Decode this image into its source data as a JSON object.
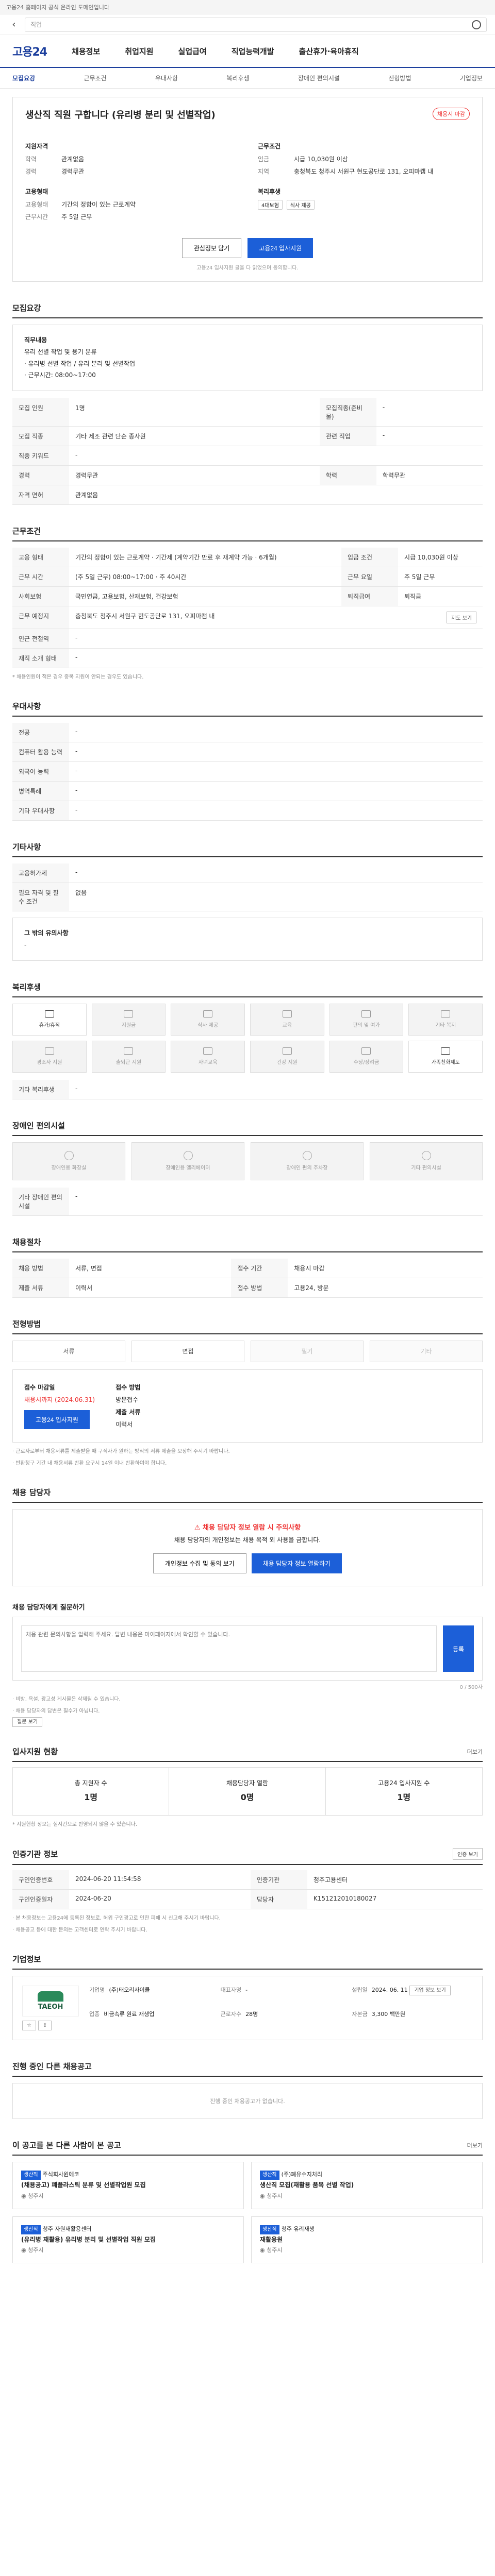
{
  "topbar": {
    "notice": "고용24 홈페이지 공식 온라인 도메인입니다"
  },
  "search": {
    "placeholder": "직업"
  },
  "gnb": {
    "logo": "고용24",
    "items": [
      "채용정보",
      "취업지원",
      "실업급여",
      "직업능력개발",
      "출산휴가·육아휴직"
    ]
  },
  "subtabs": [
    "모집요강",
    "근무조건",
    "우대사항",
    "복리후생",
    "장애인 편의시설",
    "전형방법",
    "기업정보"
  ],
  "job": {
    "title": "생산직 직원 구합니다 (유리병 분리 및 선별작업)",
    "status": "채용시 마감",
    "company_h": "지원자격",
    "edu_k": "학력",
    "edu_v": "관계없음",
    "career_k": "경력",
    "career_v": "경력무관",
    "cond_h": "근무조건",
    "pay_k": "임금",
    "pay_v": "시급 10,030원 이상",
    "area_k": "지역",
    "area_v": "충청북도 청주시 서원구 현도공단로 131, 오피마캠 내",
    "emp_h": "고용형태",
    "type_k": "고용형태",
    "type_v": "기간의 정함이 있는 근로계약",
    "hours_k": "근무시간",
    "hours_v": "주 5일 근무",
    "benefit_h": "복리후생",
    "benefit_tags": [
      "4대보험",
      "식사 제공"
    ],
    "btn_scrap": "관심정보 담기",
    "btn_apply": "고용24 입사지원",
    "apply_note": "고용24 입사지원 글을 다 읽었으며 동의합니다."
  },
  "recruit": {
    "title": "모집요강",
    "desc_lines": [
      "직무내용",
      "유리 선별 작업 및 용기 분류",
      "· 유리병 선별 작업 / 유리 분리 및 선별작업",
      "· 근무시간: 08:00~17:00"
    ],
    "rows": [
      {
        "k": "모집 인원",
        "v": "1명",
        "k2": "모집직종(준비물)",
        "v2": "-"
      },
      {
        "k": "모집 직종",
        "v": "기타 제조 관련 단순 종사원",
        "k2": "관련 직업",
        "v2": "-"
      },
      {
        "k": "직종 키워드",
        "v": "-",
        "k2": "",
        "v2": ""
      },
      {
        "k": "경력",
        "v": "경력무관",
        "k2": "학력",
        "v2": "학력무관"
      },
      {
        "k": "자격 면허",
        "v": "관계없음",
        "k2": "",
        "v2": ""
      }
    ]
  },
  "work": {
    "title": "근무조건",
    "rows": [
      {
        "k": "고용 형태",
        "v": "기간의 정함이 있는 근로계약 · 기간제 (계약기간 만료 후 재계약 가능 · 6개월)"
      },
      {
        "k": "임금 조건",
        "v": "시급 10,030원 이상"
      },
      {
        "k": "근무 시간",
        "v": "(주 5일 근무) 08:00~17:00 · 주 40시간"
      },
      {
        "k": "근무 요일",
        "v": "주 5일 근무"
      },
      {
        "k": "사회보험",
        "v": "국민연금, 고용보험, 산재보험, 건강보험"
      },
      {
        "k": "퇴직급여",
        "v": "퇴직금"
      },
      {
        "k": "근무 예정지",
        "v": "충청북도 청주시 서원구 현도공단로 131, 오피마캠 내"
      },
      {
        "k": "인근 전철역",
        "v": "-"
      },
      {
        "k": "재직 소개 형태",
        "v": "-"
      }
    ],
    "note": "* 채용인원이 적은 경우 중복 지원이 안되는 경우도 있습니다.",
    "map_btn": "지도 보기"
  },
  "pref": {
    "title": "우대사항",
    "rows": [
      {
        "k": "전공",
        "v": "-"
      },
      {
        "k": "컴퓨터 활용 능력",
        "v": "-"
      },
      {
        "k": "외국어 능력",
        "v": "-"
      },
      {
        "k": "병역특례",
        "v": "-"
      },
      {
        "k": "기타 우대사항",
        "v": "-"
      }
    ]
  },
  "extra": {
    "title": "기타사항",
    "rows": [
      {
        "k": "고용허가제",
        "v": "-"
      },
      {
        "k": "필요 자격 및 필수 조건",
        "v": "없음"
      }
    ],
    "notes_k": "그 밖의 유의사항",
    "notes_v": "-"
  },
  "welfare": {
    "title": "복리후생",
    "items": [
      "휴가/휴직",
      "지원금",
      "식사 제공",
      "교육",
      "편의 및 여가",
      "기타 복지",
      "경조사 지원",
      "출퇴근 지원",
      "자녀교육",
      "건강 지원",
      "수당/장려금",
      "가족친화제도"
    ],
    "active": [
      0,
      11
    ],
    "other_k": "기타 복리후생",
    "other_v": "-"
  },
  "facility": {
    "title": "장애인 편의시설",
    "items": [
      "장애인용 화장실",
      "장애인용 엘리베이터",
      "장애인 편의 주차장",
      "기타 편의시설"
    ],
    "other_k": "기타 장애인 편의시설",
    "other_v": "-"
  },
  "selection": {
    "title": "채용절차",
    "rows": [
      {
        "k": "채용 방법",
        "v": "서류, 면접"
      },
      {
        "k": "접수 기간",
        "v": "채용시 마감"
      },
      {
        "k": "제출 서류",
        "v": "이력서"
      },
      {
        "k": "접수 방법",
        "v": "고용24, 방문"
      }
    ]
  },
  "method": {
    "title": "전형방법",
    "btns": [
      "서류",
      "면접",
      "필기",
      "기타"
    ],
    "off": [
      2,
      3
    ],
    "deadline_k": "접수 마감일",
    "deadline_v": "채용시까지 (2024.06.31)",
    "app_k": "접수 방법",
    "app_v": "방문접수",
    "docs_k": "제출 서류",
    "docs_v": "이력서",
    "apply_btn": "고용24 입사지원",
    "notes": [
      "· 근로자로부터 채용서류를 제출받을 때 구직자가 원하는 방식의 서류 제출을 보장해 주시기 바랍니다.",
      "· 반환청구 기간 내 채용서류 반환 요구시 14일 이내 반환하여야 합니다."
    ]
  },
  "contact": {
    "title": "채용 담당자",
    "warn_title": "채용 담당자 정보 열람 시 주의사항",
    "warn_text": "채용 담당자의 개인정보는 채용 목적 외 사용을 금합니다.",
    "btn1": "개인정보 수집 및 동의 보기",
    "btn2": "채용 담당자 정보 열람하기"
  },
  "qa": {
    "title": "채용 담당자에게 질문하기",
    "placeholder": "채용 관련 문의사항을 입력해 주세요. 답변 내용은 마이페이지에서 확인할 수 있습니다.",
    "submit": "등록",
    "count": "0 / 500자",
    "notes": [
      "· 비방, 욕설, 광고성 게시물은 삭제될 수 있습니다.",
      "· 채용 담당자의 답변은 필수가 아닙니다."
    ],
    "more_btn": "질문 보기"
  },
  "applicants": {
    "title": "입사지원 현황",
    "more": "더보기",
    "items": [
      {
        "label": "총 지원자 수",
        "value": "1명"
      },
      {
        "label": "채용담당자 열람",
        "value": "0명"
      },
      {
        "label": "고용24 입사지원 수",
        "value": "1명"
      }
    ],
    "note": "* 지원현황 정보는 실시간으로 반영되지 않을 수 있습니다."
  },
  "admin": {
    "title": "인증기관 정보",
    "btn": "인증 보기",
    "rows": [
      {
        "k": "구인인증번호",
        "v": "2024-06-20 11:54:58",
        "k2": "인증기관",
        "v2": "청주고용센터"
      },
      {
        "k": "구인인증일자",
        "v": "2024-06-20",
        "k2": "담당자",
        "v2": "K151212010180027"
      }
    ],
    "notes": [
      "· 본 채용정보는 고용24에 등록된 정보로, 허위 구인광고로 인한 피해 시 신고해 주시기 바랍니다.",
      "· 채용공고 등에 대한 문의는 고객센터로 연락 주시기 바랍니다."
    ]
  },
  "company": {
    "title": "기업정보",
    "logo_text": "TAEOH",
    "fields": [
      {
        "k": "기업명",
        "v": "(주)태오리사이클"
      },
      {
        "k": "업종",
        "v": "비금속류 원료 재생업"
      },
      {
        "k": "대표자명",
        "v": "-"
      },
      {
        "k": "설립일",
        "v": "2024. 06. 11"
      },
      {
        "k": "자본금",
        "v": "3,300 백만원"
      },
      {
        "k": "근로자수",
        "v": "28명"
      }
    ],
    "btn": "기업 정보 보기"
  },
  "ongoing": {
    "title": "진행 중인 다른 채용공고",
    "empty": "진행 중인 채용공고가 없습니다."
  },
  "related": {
    "title": "이 공고를 본 다른 사람이 본 공고",
    "more": "더보기",
    "cards": [
      {
        "tag": "생산직",
        "company": "주식회사원에코",
        "title": "(채용공고) 폐플라스틱 분류 및 선별작업원 모집",
        "place": "청주시"
      },
      {
        "tag": "생산직",
        "company": "(주)폐유수지처리",
        "title": "생산직 모집(재활용 품목 선별 작업)",
        "place": "청주시"
      },
      {
        "tag": "생산직",
        "company": "청주 자원재활용센터",
        "title": "(유리병 재활용) 유리병 분리 및 선별작업 직원 모집",
        "place": "청주시"
      },
      {
        "tag": "생산직",
        "company": "청주 유리재생",
        "title": "재활용원",
        "place": "청주시"
      }
    ]
  },
  "colors": {
    "primary": "#1c3f9d",
    "accent": "#1c5fd8",
    "warn": "#e33333"
  }
}
